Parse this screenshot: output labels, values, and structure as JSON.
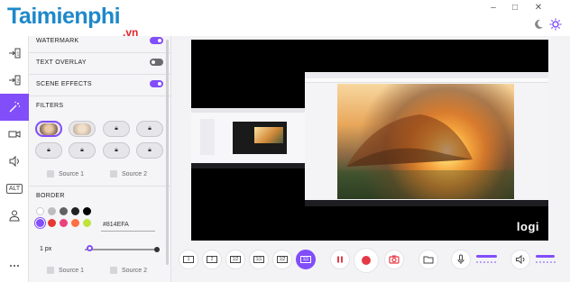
{
  "titlebar": {
    "brand": "Taimienphi",
    "brand_suffix": ".vn",
    "minimize": "–",
    "maximize": "□",
    "close": "✕"
  },
  "nav": {
    "items": [
      {
        "name": "input-1-icon",
        "glyph": "→1"
      },
      {
        "name": "input-2-icon",
        "glyph": "→2"
      },
      {
        "name": "effects-wand-icon",
        "glyph": "✦"
      },
      {
        "name": "camera-icon",
        "glyph": "cam"
      },
      {
        "name": "audio-icon",
        "glyph": "vol"
      },
      {
        "name": "alt-icon",
        "glyph": "ALT"
      },
      {
        "name": "user-icon",
        "glyph": "user"
      },
      {
        "name": "more-icon",
        "glyph": "•••"
      }
    ]
  },
  "panel": {
    "watermark": {
      "label": "WATERMARK",
      "on": true
    },
    "text_overlay": {
      "label": "TEXT OVERLAY",
      "on": false
    },
    "scene_effects": {
      "label": "SCENE EFFECTS",
      "on": true
    },
    "filters_title": "FILTERS",
    "source_1": "Source 1",
    "source_2": "Source 2",
    "border_title": "BORDER",
    "border_hex": "#814EFA",
    "border_width": "1 px",
    "border_width_fraction": 0.05,
    "colors": [
      "#ffffff",
      "#bdbdbd",
      "#616161",
      "#212121",
      "#000000",
      "#814efa",
      "#e53935",
      "#ec407a",
      "#ff7043",
      "#c0e33c",
      "#3ddc84",
      "#26c6da",
      "#29b6f6",
      "#9575cd",
      "#ff8a65"
    ]
  },
  "preview": {
    "logo": "logi"
  },
  "toolbar": {
    "layouts": [
      "1",
      "2",
      "1|2",
      "1|1",
      "1|2",
      "1|1"
    ],
    "mic_level": 0.75,
    "speaker_level": 0.7
  },
  "accent_color": "#814efa"
}
